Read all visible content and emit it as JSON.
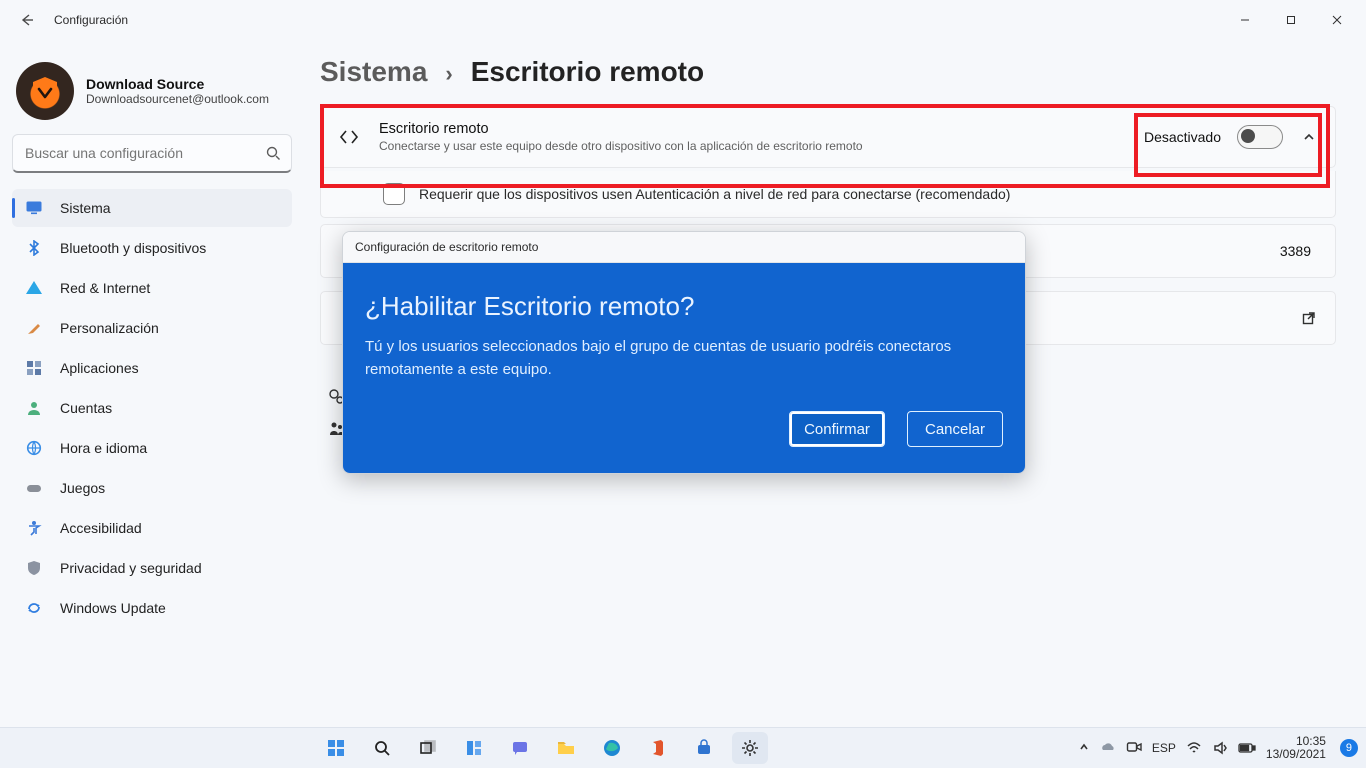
{
  "window": {
    "title": "Configuración"
  },
  "account": {
    "name": "Download Source",
    "email": "Downloadsourcenet@outlook.com"
  },
  "search": {
    "placeholder": "Buscar una configuración"
  },
  "nav": {
    "items": [
      {
        "label": "Sistema",
        "icon": "monitor",
        "selected": true
      },
      {
        "label": "Bluetooth y dispositivos",
        "icon": "bluetooth"
      },
      {
        "label": "Red & Internet",
        "icon": "wifi"
      },
      {
        "label": "Personalización",
        "icon": "brush"
      },
      {
        "label": "Aplicaciones",
        "icon": "apps"
      },
      {
        "label": "Cuentas",
        "icon": "user"
      },
      {
        "label": "Hora e idioma",
        "icon": "globe-clock"
      },
      {
        "label": "Juegos",
        "icon": "gamepad"
      },
      {
        "label": "Accesibilidad",
        "icon": "accessibility"
      },
      {
        "label": "Privacidad y seguridad",
        "icon": "shield"
      },
      {
        "label": "Windows Update",
        "icon": "update"
      }
    ]
  },
  "breadcrumb": {
    "parent": "Sistema",
    "separator": "›",
    "current": "Escritorio remoto"
  },
  "panels": {
    "remote": {
      "title": "Escritorio remoto",
      "subtitle": "Conectarse y usar este equipo desde otro dispositivo con la aplicación de escritorio remoto",
      "state_label": "Desactivado"
    },
    "nla": {
      "label": "Requerir que los dispositivos usen Autenticación a nivel de red para conectarse (recomendado)"
    },
    "port": {
      "value": "3389"
    }
  },
  "dialog": {
    "caption": "Configuración de escritorio remoto",
    "heading": "¿Habilitar Escritorio remoto?",
    "body": "Tú y los usuarios seleccionados bajo el grupo de cuentas de usuario podréis conectaros remotamente a este equipo.",
    "confirm": "Confirmar",
    "cancel": "Cancelar"
  },
  "taskbar": {
    "lang": "ESP",
    "clock_time": "10:35",
    "clock_date": "13/09/2021",
    "notification_count": "9"
  },
  "colors": {
    "accent": "#0067c0",
    "dialog_bg": "#1164cf",
    "highlight": "#ed1c24"
  }
}
